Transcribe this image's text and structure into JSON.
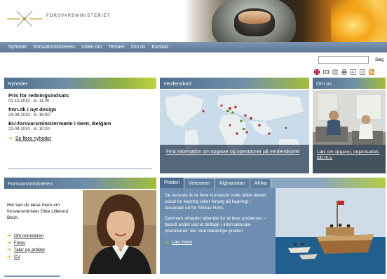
{
  "header": {
    "ministry_name": "FORSVARSMINISTERIET"
  },
  "nav": {
    "items": [
      "Nyheder",
      "Forsvarsministeren",
      "Viden om",
      "Temaer",
      "Om os",
      "Kontakt"
    ]
  },
  "search": {
    "value": "",
    "button_label": "Søg"
  },
  "utility_icons": [
    "uk-flag-icon",
    "sign-language-icon",
    "audio-icon",
    "print-icon",
    "text-size-icon",
    "sitemap-icon",
    "rss-icon"
  ],
  "news": {
    "title": "Nyheder",
    "items": [
      {
        "title": "Pris for redningsindsats",
        "date": "01-10-2010 - kl. 11:00"
      },
      {
        "title": "fmn.dk i nyt design",
        "date": "24-09-2010 - kl. 16:00"
      },
      {
        "title": "EU-forsvarsministermøde i Gent, Belgien",
        "date": "23-09-2010 - kl. 10:20"
      }
    ],
    "more_label": "Se flere nyheder"
  },
  "worldmap": {
    "title": "Verdenskort",
    "caption": "Find information om opgaver og operationer på verdenskortet"
  },
  "omos": {
    "title": "Om os",
    "caption": "Læs om opgaver, organisation, job m.v."
  },
  "minister": {
    "title": "Forsvarsministeren",
    "intro": "Her kan du læse mere om forsvarsminister Gitte Lillelund Bech.",
    "links": [
      "Om ministeren",
      "Fotos",
      "Taler og artikler",
      "CV"
    ]
  },
  "tabs": {
    "items": [
      "Pirateri",
      "Veteraner",
      "Afghanistan",
      "Afrika"
    ],
    "active_index": 0,
    "content": {
      "paragraph1": "De seneste år er flere hundrede civile skibe blevet udsat for kapring (eller forsøg på kapring) i farvandet ud for Afrikas Horn.",
      "paragraph2": "Danmark arbejder løbende for at løse problemet – blandt andet ved at deltage i internationale operationer, der skal bekæmpe pirateri.",
      "more_label": "Læs mere"
    }
  },
  "colors": {
    "nav_blue": "#6a86a6",
    "accent_green": "#a3bd3d",
    "link_arrow": "#e8a500",
    "tab_content_bg": "#6d8eb1"
  }
}
